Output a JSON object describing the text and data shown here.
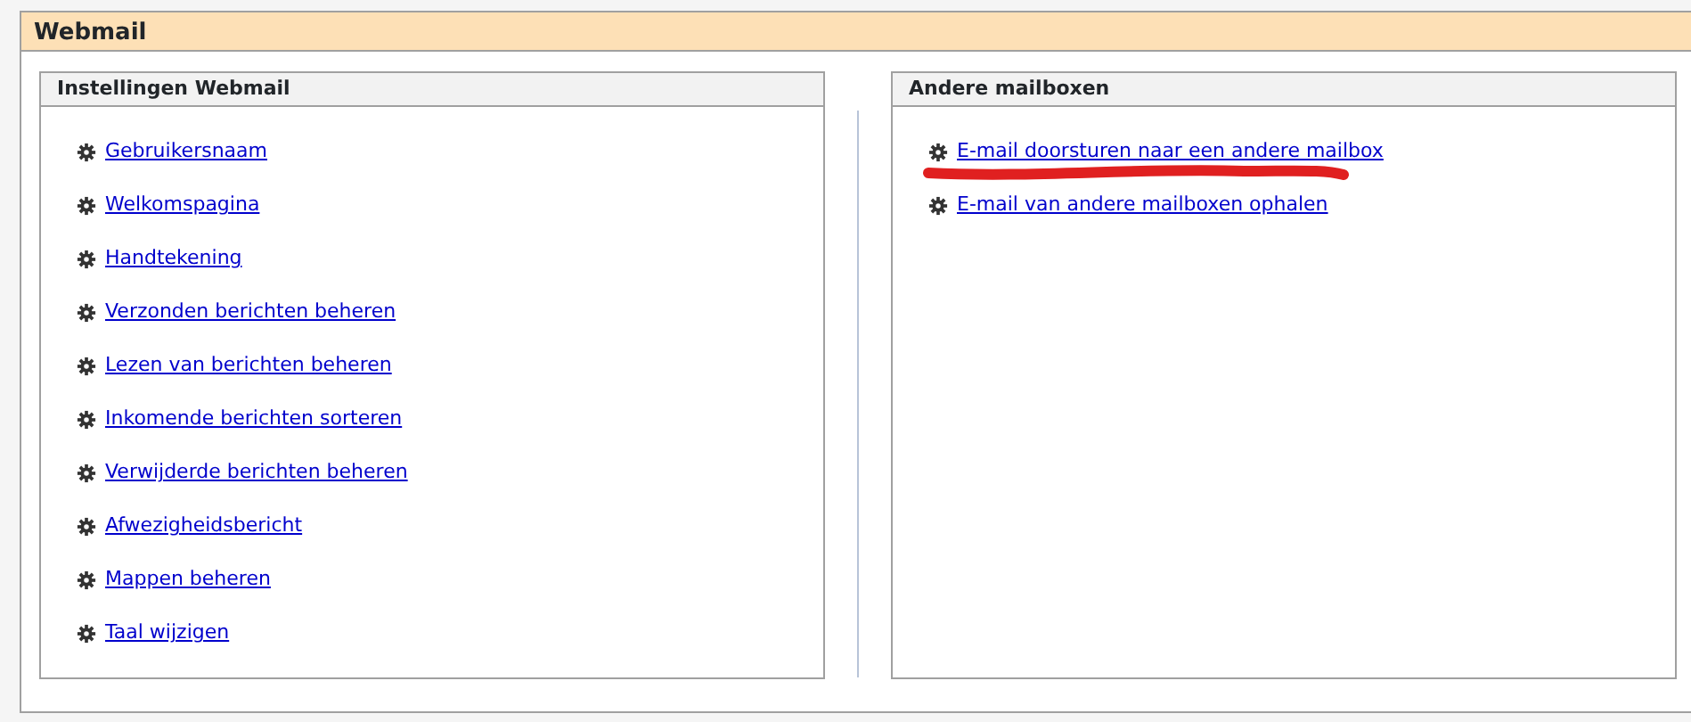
{
  "page": {
    "title": "Webmail"
  },
  "panels": [
    {
      "title": "Instellingen Webmail",
      "links": [
        {
          "label": "Gebruikersnaam",
          "marked": false
        },
        {
          "label": "Welkomspagina",
          "marked": false
        },
        {
          "label": "Handtekening",
          "marked": false
        },
        {
          "label": "Verzonden berichten beheren",
          "marked": false
        },
        {
          "label": "Lezen van berichten beheren",
          "marked": false
        },
        {
          "label": "Inkomende berichten sorteren",
          "marked": false
        },
        {
          "label": "Verwijderde berichten beheren",
          "marked": false
        },
        {
          "label": "Afwezigheidsbericht",
          "marked": false
        },
        {
          "label": "Mappen beheren",
          "marked": false
        },
        {
          "label": "Taal wijzigen",
          "marked": false
        }
      ]
    },
    {
      "title": "Andere mailboxen",
      "links": [
        {
          "label": "E-mail doorsturen naar een andere mailbox",
          "marked": true
        },
        {
          "label": "E-mail van andere mailboxen ophalen",
          "marked": false
        }
      ]
    }
  ]
}
